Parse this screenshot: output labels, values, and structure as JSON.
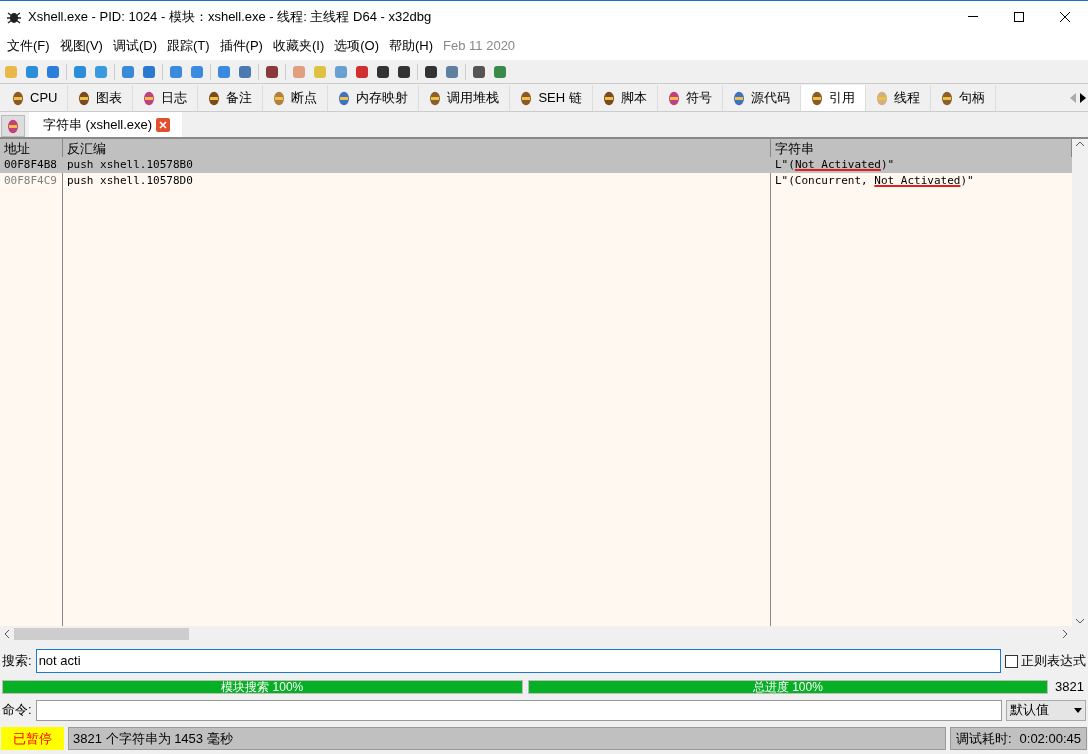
{
  "window": {
    "title": "Xshell.exe - PID: 1024 - 模块：xshell.exe - 线程: 主线程 D64 - x32dbg"
  },
  "menu": [
    "文件(F)",
    "视图(V)",
    "调试(D)",
    "跟踪(T)",
    "插件(P)",
    "收藏夹(I)",
    "选项(O)",
    "帮助(H)"
  ],
  "build_date": "Feb 11 2020",
  "tabs": [
    {
      "label": "CPU",
      "selected": false
    },
    {
      "label": "图表",
      "selected": false
    },
    {
      "label": "日志",
      "selected": false
    },
    {
      "label": "备注",
      "selected": false
    },
    {
      "label": "断点",
      "selected": false
    },
    {
      "label": "内存映射",
      "selected": false
    },
    {
      "label": "调用堆栈",
      "selected": false
    },
    {
      "label": "SEH 链",
      "selected": false
    },
    {
      "label": "脚本",
      "selected": false
    },
    {
      "label": "符号",
      "selected": false
    },
    {
      "label": "源代码",
      "selected": false
    },
    {
      "label": "引用",
      "selected": true
    },
    {
      "label": "线程",
      "selected": false
    },
    {
      "label": "句柄",
      "selected": false
    }
  ],
  "subtab": {
    "label": "字符串 (xshell.exe)"
  },
  "table": {
    "columns": [
      "地址",
      "反汇编",
      "字符串"
    ],
    "rows": [
      {
        "selected": true,
        "address": "00F8F4B8",
        "disasm": "push xshell.10578B0",
        "string": [
          {
            "text": "L\"(",
            "match": false
          },
          {
            "text": "Not Activated",
            "match": true
          },
          {
            "text": ")\"",
            "match": false
          }
        ]
      },
      {
        "selected": false,
        "address": "00F8F4C9",
        "disasm": "push xshell.10578D0",
        "string": [
          {
            "text": "L\"(Concurrent, ",
            "match": false
          },
          {
            "text": "Not Activated",
            "match": true
          },
          {
            "text": ")\"",
            "match": false
          }
        ]
      }
    ]
  },
  "search": {
    "label": "搜索:",
    "value": "not acti",
    "regex_label": "正则表达式",
    "regex_checked": false
  },
  "progress": [
    {
      "text": "模块搜索 100%",
      "level": 1
    },
    {
      "text": "总进度 100%",
      "level": 1
    }
  ],
  "count": "3821",
  "command": {
    "label": "命令:",
    "dropdown": "默认值"
  },
  "status_bar": {
    "state": "已暂停",
    "message": "3821 个字符串为 1453 毫秒",
    "elapsed_label": "调试耗时:",
    "elapsed": "0:02:00:45"
  }
}
